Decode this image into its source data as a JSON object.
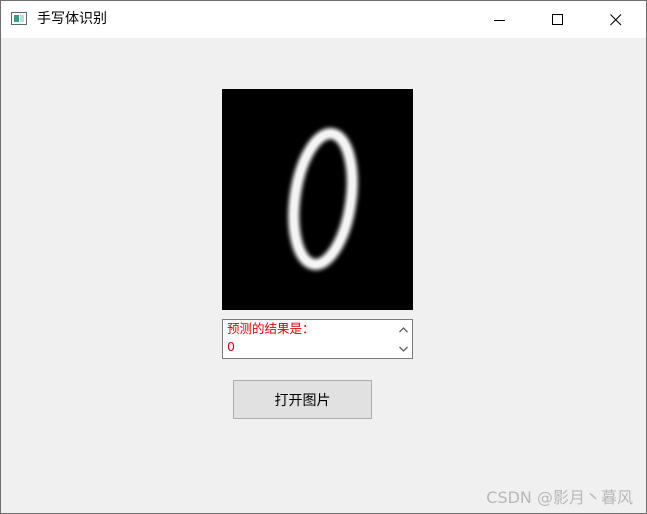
{
  "window": {
    "title": "手写体识别",
    "icon": "app-window-icon",
    "controls": [
      "minimize-icon",
      "maximize-icon",
      "close-icon"
    ]
  },
  "preview": {
    "content": "digit-image",
    "background": "#000000"
  },
  "result": {
    "line1": "预测的结果是：",
    "line2": "0",
    "text_color": "#e00000"
  },
  "buttons": {
    "open_image": "打开图片"
  },
  "watermark": "CSDN @影月丶暮风"
}
